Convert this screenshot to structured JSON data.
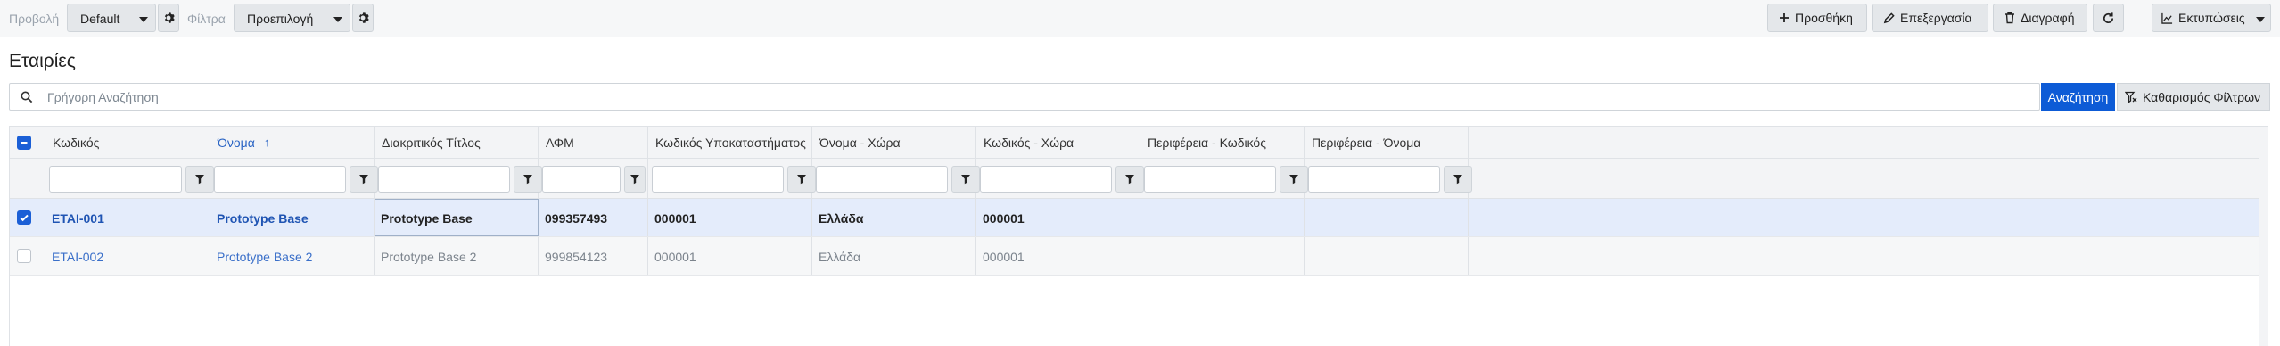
{
  "toolbar": {
    "view_label": "Προβολή",
    "view_value": "Default",
    "filter_label": "Φίλτρα",
    "filter_value": "Προεπιλογή",
    "add_label": "Προσθήκη",
    "edit_label": "Επεξεργασία",
    "delete_label": "Διαγραφή",
    "print_label": "Εκτυπώσεις"
  },
  "page": {
    "title": "Εταιρίες"
  },
  "search": {
    "placeholder": "Γρήγορη Αναζήτηση",
    "search_button": "Αναζήτηση",
    "clear_button": "Καθαρισμός Φίλτρων"
  },
  "grid": {
    "columns": [
      "Κωδικός",
      "Όνομα",
      "Διακριτικός Τίτλος",
      "ΑΦΜ",
      "Κωδικός Υποκαταστήματος",
      "Όνομα - Χώρα",
      "Κωδικός - Χώρα",
      "Περιφέρεια - Κωδικός",
      "Περιφέρεια - Όνομα"
    ],
    "sorted_column": "Όνομα",
    "sort_direction": "asc",
    "rows": [
      {
        "selected": true,
        "cells": [
          "ETAI-001",
          "Prototype Base",
          "Prototype Base",
          "099357493",
          "000001",
          "Ελλάδα",
          "000001",
          "",
          ""
        ]
      },
      {
        "selected": false,
        "cells": [
          "ETAI-002",
          "Prototype Base 2",
          "Prototype Base 2",
          "999854123",
          "000001",
          "Ελλάδα",
          "000001",
          "",
          ""
        ]
      }
    ]
  },
  "colors": {
    "accent": "#0d5bd6",
    "link": "#1f54b3",
    "selected_row": "#e4ecfb"
  }
}
